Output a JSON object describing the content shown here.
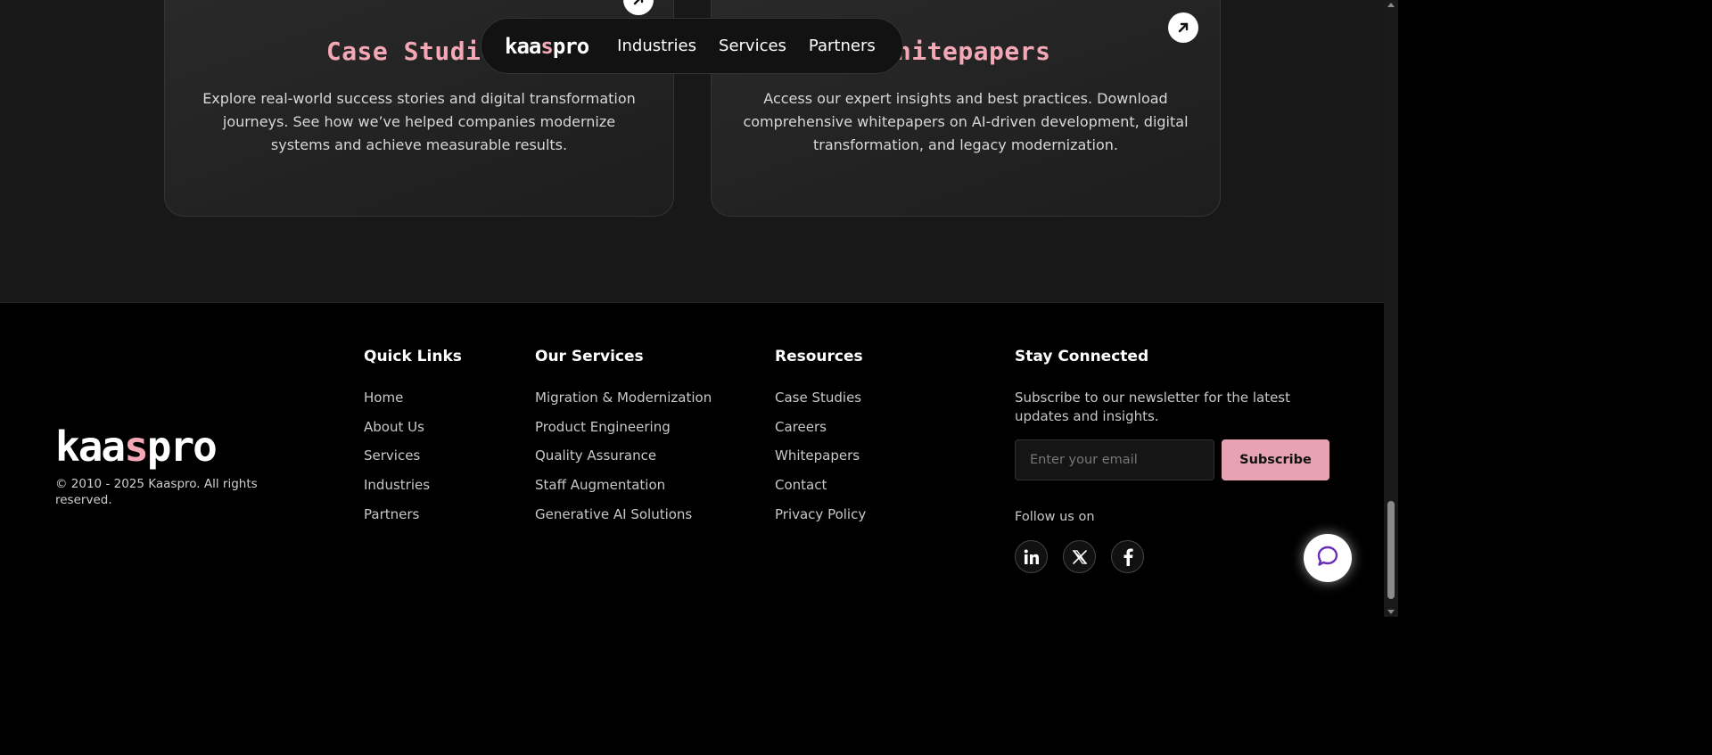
{
  "nav": {
    "logo_pre": "kaa",
    "logo_accent": "s",
    "logo_post": "pro",
    "links": [
      "Industries",
      "Services",
      "Partners"
    ]
  },
  "cards": [
    {
      "title": "Case Studies",
      "description": "Explore real-world success stories and digital transformation journeys. See how we’ve helped companies modernize systems and achieve measurable results.",
      "icon": "arrow-up-right-icon"
    },
    {
      "title": "Whitepapers",
      "description": "Access our expert insights and best practices. Download comprehensive whitepapers on AI-driven development, digital transformation, and legacy modernization.",
      "icon": "arrow-up-right-icon"
    }
  ],
  "footer": {
    "logo_pre": "kaa",
    "logo_accent": "s",
    "logo_post": "pro",
    "copyright": "© 2010 - 2025 Kaaspro. All rights reserved.",
    "quick_links": {
      "title": "Quick Links",
      "items": [
        "Home",
        "About Us",
        "Services",
        "Industries",
        "Partners"
      ]
    },
    "services": {
      "title": "Our Services",
      "items": [
        "Migration & Modernization",
        "Product Engineering",
        "Quality Assurance",
        "Staff Augmentation",
        "Generative AI Solutions"
      ]
    },
    "resources": {
      "title": "Resources",
      "items": [
        "Case Studies",
        "Careers",
        "Whitepapers",
        "Contact",
        "Privacy Policy"
      ]
    },
    "connect": {
      "title": "Stay Connected",
      "text": "Subscribe to our newsletter for the latest updates and insights.",
      "email_placeholder": "Enter your email",
      "email_value": "",
      "subscribe_label": "Subscribe",
      "follow_label": "Follow us on",
      "socials": [
        "linkedin-icon",
        "x-twitter-icon",
        "facebook-icon"
      ]
    }
  },
  "chat": {
    "icon": "chat-bubble-icon"
  },
  "colors": {
    "accent_pink": "#f4a7b5",
    "subscribe_bg": "#e8a3b2",
    "chat_icon": "#6a2fb8",
    "section_bg": "#181818",
    "footer_bg": "#000000"
  }
}
